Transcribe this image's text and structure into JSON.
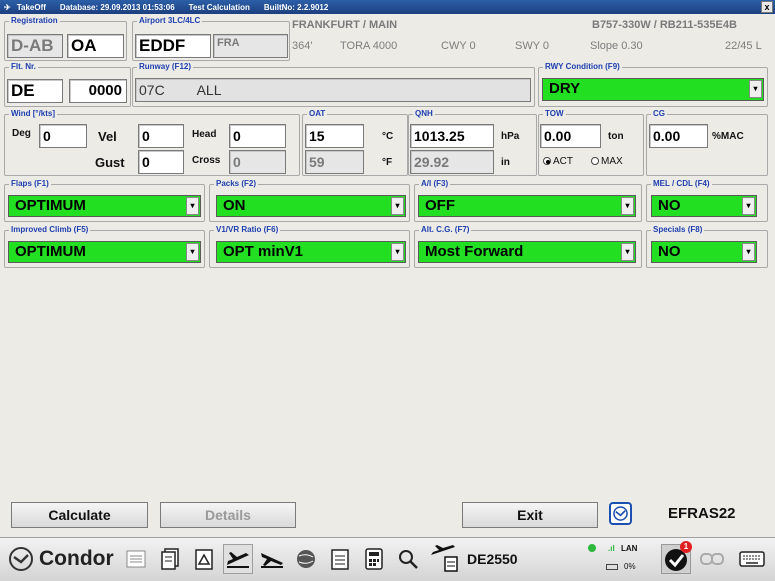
{
  "titlebar": {
    "app": "TakeOff",
    "database": "Database: 29.09.2013  01:53:06",
    "mode": "Test Calculation",
    "build": "BuiltNo: 2.2.9012",
    "close": "x"
  },
  "registration": {
    "label": "Registration",
    "prefix": "D-AB",
    "suffix": "OA"
  },
  "airport": {
    "label": "Airport 3LC/4LC",
    "icao": "EDDF",
    "iata": "FRA",
    "name": "FRANKFURT / MAIN",
    "elevation": "364'",
    "tora": "TORA 4000",
    "cwy": "CWY 0",
    "swy": "SWY 0",
    "slope": "Slope 0.30",
    "heading": "22/45 L",
    "aircraft": "B757-330W / RB211-535E4B"
  },
  "flight": {
    "label": "Flt. Nr.",
    "carrier": "DE",
    "number": "0000"
  },
  "runway": {
    "label": "Runway (F12)",
    "value": "07C",
    "intersection": "ALL"
  },
  "rwy_condition": {
    "label": "RWY Condition (F9)",
    "value": "DRY"
  },
  "wind": {
    "label": "Wind [°/kts]",
    "deg_label": "Deg",
    "deg": "0",
    "vel_label": "Vel",
    "vel": "0",
    "gust_label": "Gust",
    "gust": "0",
    "head_label": "Head",
    "head": "0",
    "cross_label": "Cross",
    "cross": "0"
  },
  "oat": {
    "label": "OAT",
    "celsius": "15",
    "celsius_unit": "°C",
    "fahrenheit": "59",
    "fahrenheit_unit": "°F"
  },
  "qnh": {
    "label": "QNH",
    "hpa": "1013.25",
    "hpa_unit": "hPa",
    "inhg": "29.92",
    "inhg_unit": "in"
  },
  "tow": {
    "label": "TOW",
    "value": "0.00",
    "unit": "ton",
    "act": "ACT",
    "max": "MAX"
  },
  "cg": {
    "label": "CG",
    "value": "0.00",
    "unit": "%MAC"
  },
  "flaps": {
    "label": "Flaps (F1)",
    "value": "OPTIMUM"
  },
  "packs": {
    "label": "Packs (F2)",
    "value": "ON"
  },
  "ai": {
    "label": "A/I (F3)",
    "value": "OFF"
  },
  "mel": {
    "label": "MEL / CDL (F4)",
    "value": "NO"
  },
  "improved_climb": {
    "label": "Improved Climb (F5)",
    "value": "OPTIMUM"
  },
  "v1vr": {
    "label": "V1/VR Ratio (F6)",
    "value": "OPT minV1"
  },
  "altcg": {
    "label": "Alt. C.G. (F7)",
    "value": "Most Forward"
  },
  "specials": {
    "label": "Specials (F8)",
    "value": "NO"
  },
  "buttons": {
    "calculate": "Calculate",
    "details": "Details",
    "exit": "Exit"
  },
  "device_id": "EFRAS22",
  "taskbar": {
    "brand": "Condor",
    "aircraft_reg": "DE2550",
    "network": "LAN",
    "battery": "0%",
    "notifications": "1"
  },
  "colors": {
    "accent_green": "#22e021",
    "label_blue": "#1e3fb0",
    "title_blue": "#1c3f80"
  }
}
